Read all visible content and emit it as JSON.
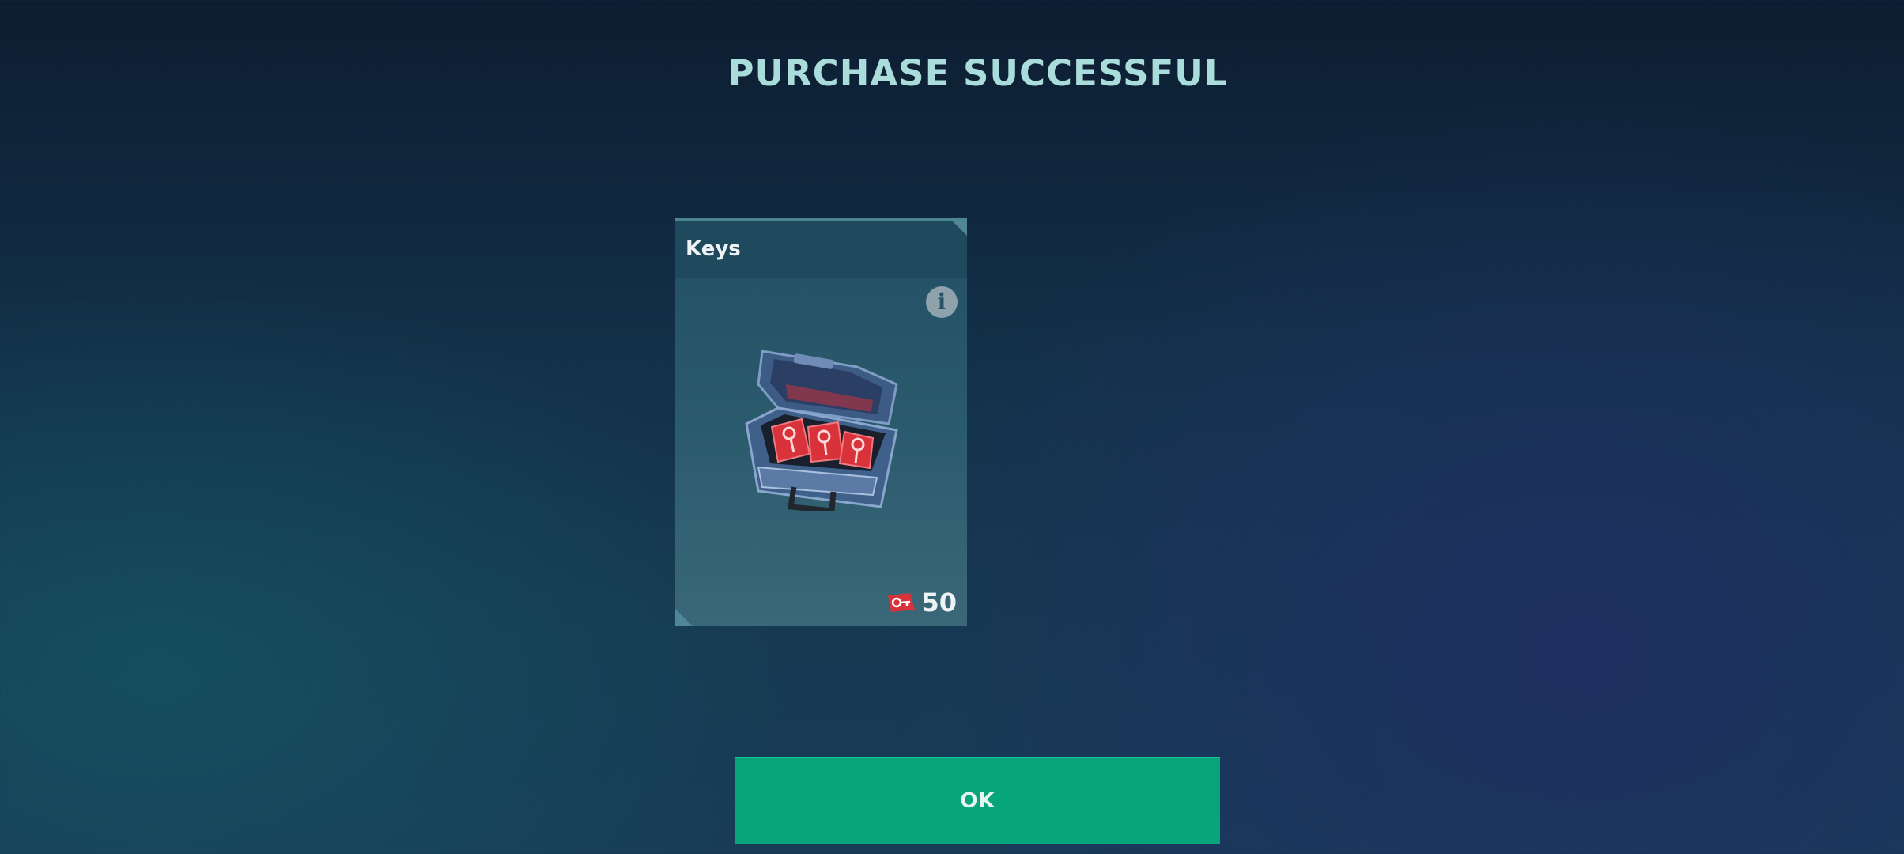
{
  "dialog": {
    "title": "PURCHASE SUCCESSFUL"
  },
  "item_card": {
    "title": "Keys",
    "info_icon": "info-icon",
    "info_glyph": "i",
    "image": "key-chest-image",
    "price": {
      "currency_icon": "key-currency-icon",
      "amount": "50"
    }
  },
  "actions": {
    "ok_label": "OK"
  },
  "colors": {
    "title": "#a9dcdb",
    "ok_button": "#08a57c",
    "card": "#2a5a6d",
    "key_red": "#d8323a"
  }
}
